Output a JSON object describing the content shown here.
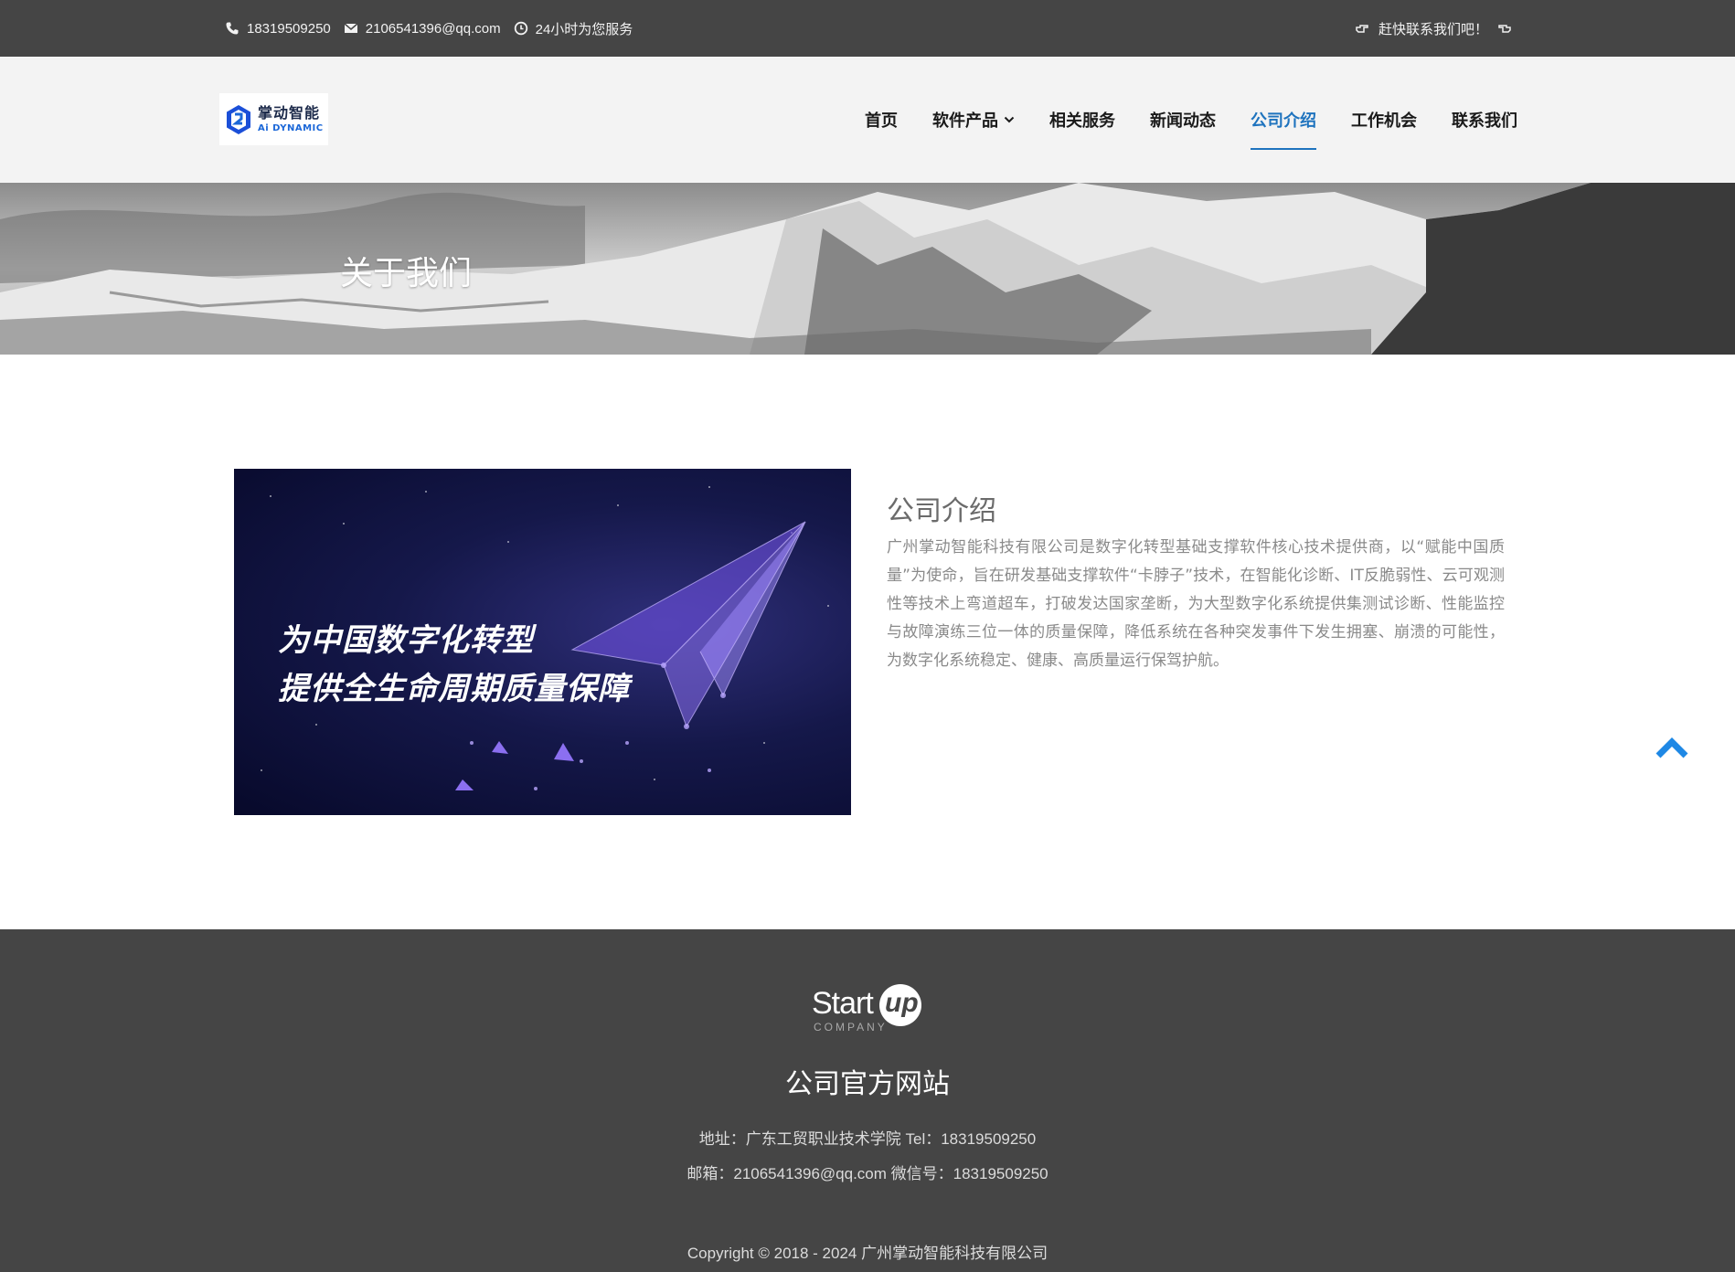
{
  "topbar": {
    "phone": "18319509250",
    "email": "2106541396@qq.com",
    "hours": "24小时为您服务",
    "cta": "赶快联系我们吧！"
  },
  "header": {
    "logo_cn": "掌动智能",
    "logo_en": "Ai DYNAMIC",
    "nav": [
      {
        "label": "首页"
      },
      {
        "label": "软件产品"
      },
      {
        "label": "相关服务"
      },
      {
        "label": "新闻动态"
      },
      {
        "label": "公司介绍"
      },
      {
        "label": "工作机会"
      },
      {
        "label": "联系我们"
      }
    ],
    "active_nav": "公司介绍"
  },
  "banner": {
    "title": "关于我们"
  },
  "about": {
    "image_line1": "为中国数字化转型",
    "image_line2": "提供全生命周期质量保障",
    "title": "公司介绍",
    "text": "广州掌动智能科技有限公司是数字化转型基础支撑软件核心技术提供商，以“赋能中国质量”为使命，旨在研发基础支撑软件“卡脖子”技术，在智能化诊断、IT反脆弱性、云可观测性等技术上弯道超车，打破发达国家垄断，为大型数字化系统提供集测试诊断、性能监控与故障演练三位一体的质量保障，降低系统在各种突发事件下发生拥塞、崩溃的可能性，为数字化系统稳定、健康、高质量运行保驾护航。"
  },
  "footer": {
    "logo_start": "Start",
    "logo_up": "up",
    "logo_company": "COMPANY",
    "title": "公司官方网站",
    "address_line": "地址：广东工贸职业技术学院 Tel：18319509250",
    "contact_line": "邮箱：2106541396@qq.com 微信号：18319509250",
    "copyright": "Copyright © 2018 - 2024 广州掌动智能科技有限公司"
  },
  "colors": {
    "topbar_bg": "#454545",
    "header_bg": "#f3f3f3",
    "accent": "#1e73be",
    "footer_bg": "#454545",
    "back_to_top": "#1e88e5"
  },
  "icons": [
    "phone-icon",
    "mail-icon",
    "clock-icon",
    "hand-point-icon",
    "chevron-down-icon",
    "back-to-top-icon"
  ]
}
